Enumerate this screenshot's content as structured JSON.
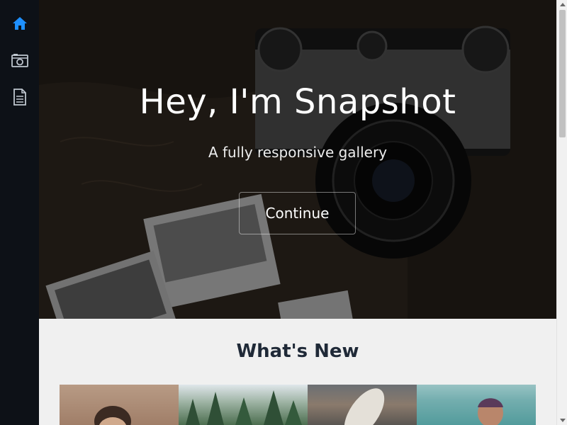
{
  "sidebar": {
    "items": [
      {
        "icon": "home-icon",
        "label": "Home",
        "active": true
      },
      {
        "icon": "camera-icon",
        "label": "Gallery"
      },
      {
        "icon": "document-icon",
        "label": "Document"
      }
    ],
    "accent": "#1e90ff"
  },
  "hero": {
    "title": "Hey, I'm Snapshot",
    "subtitle": "A fully responsive gallery",
    "button_label": "Continue"
  },
  "section": {
    "title": "What's New"
  },
  "gallery": {
    "items": [
      {
        "alt": "portrait-photo"
      },
      {
        "alt": "forest-photo"
      },
      {
        "alt": "surfboard-photo"
      },
      {
        "alt": "car-portrait-photo"
      }
    ]
  },
  "colors": {
    "sidebar_bg": "#0d1117",
    "page_bg": "#f0f0f0",
    "title_text": "#1f2937"
  }
}
